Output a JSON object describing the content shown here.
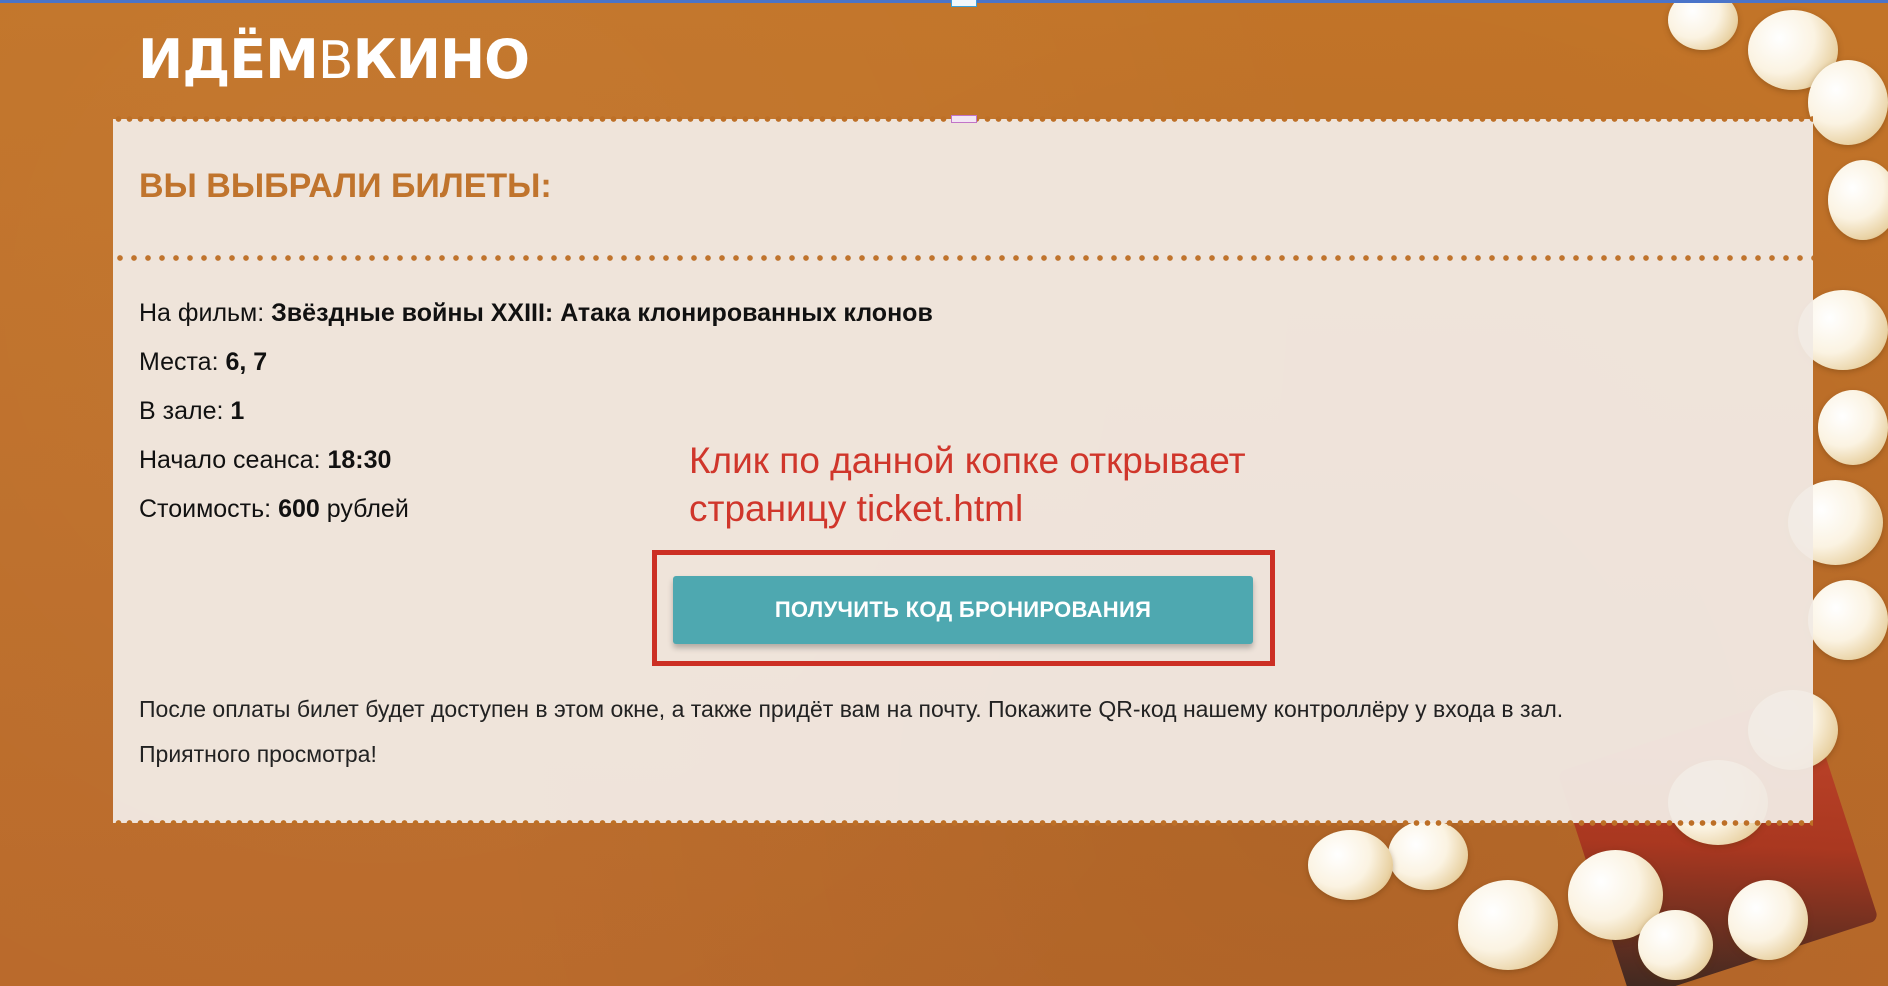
{
  "brand": {
    "logo_part1": "ИДЁМ",
    "logo_part2": "В",
    "logo_part3": "КИНО"
  },
  "ticket": {
    "title": "ВЫ ВЫБРАЛИ БИЛЕТЫ:",
    "movie_label": "На фильм:",
    "movie_value": "Звёздные войны XXIII: Атака клонированных клонов",
    "seats_label": "Места:",
    "seats_value": "6, 7",
    "hall_label": "В зале:",
    "hall_value": "1",
    "start_label": "Начало сеанса:",
    "start_value": "18:30",
    "price_label": "Стоимость:",
    "price_value": "600",
    "price_currency": "рублей",
    "button_label": "ПОЛУЧИТЬ КОД БРОНИРОВАНИЯ",
    "note_line1": "После оплаты билет будет доступен в этом окне, а также придёт вам на почту. Покажите QR-код нашему контроллёру у входа в зал.",
    "note_line2": "Приятного просмотра!"
  },
  "annotation": {
    "line1": "Клик по данной копке открывает",
    "line2": "страницу ticket.html"
  },
  "colors": {
    "background": "#bd6f26",
    "card": "#f1eae4",
    "title": "#c0742d",
    "button": "#4ea8b0",
    "annotation": "#d0362b"
  }
}
